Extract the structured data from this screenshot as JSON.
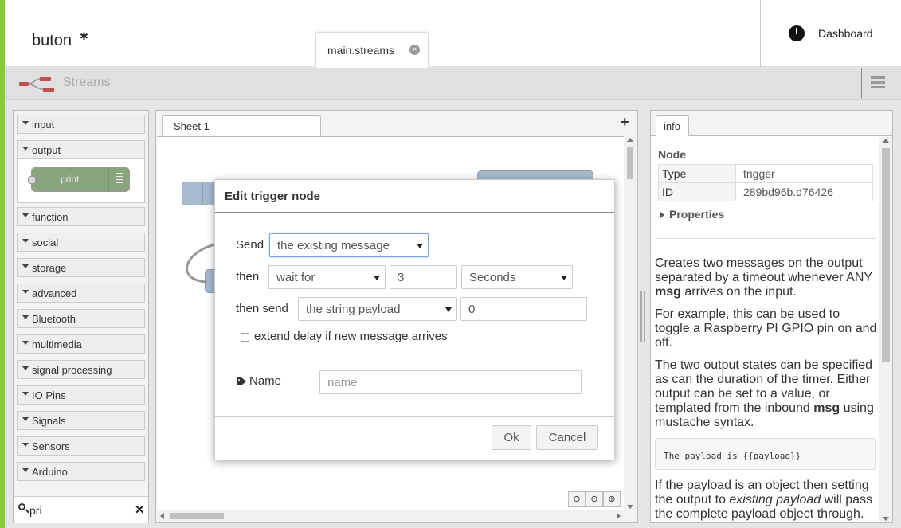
{
  "header": {
    "app_title": "buton",
    "file_tab": "main.streams",
    "dashboard_label": "Dashboard"
  },
  "streams_bar": {
    "title": "Streams"
  },
  "palette": {
    "categories": [
      {
        "label": "input"
      },
      {
        "label": "output"
      },
      {
        "label": "function"
      },
      {
        "label": "social"
      },
      {
        "label": "storage"
      },
      {
        "label": "advanced"
      },
      {
        "label": "Bluetooth"
      },
      {
        "label": "multimedia"
      },
      {
        "label": "signal processing"
      },
      {
        "label": "IO Pins"
      },
      {
        "label": "Signals"
      },
      {
        "label": "Sensors"
      },
      {
        "label": "Arduino"
      }
    ],
    "output_node": "print",
    "search_value": "pri"
  },
  "workspace": {
    "sheet_tab": "Sheet 1"
  },
  "sidebar": {
    "tab": "info",
    "node_header": "Node",
    "rows": [
      {
        "key": "Type",
        "value": "trigger"
      },
      {
        "key": "ID",
        "value": "289bd96b.d76426"
      }
    ],
    "properties_label": "Properties",
    "code_sample": "The payload is {{payload}}"
  },
  "dialog": {
    "title": "Edit trigger node",
    "send_label": "Send",
    "send_value": "the existing message",
    "then_label": "then",
    "then_value": "wait for",
    "delay_value": "3",
    "units_value": "Seconds",
    "then_send_label": "then send",
    "then_send_value": "the string payload",
    "payload_value": "0",
    "extend_label": "extend delay if new message arrives",
    "name_label": "Name",
    "name_placeholder": "name",
    "ok_label": "Ok",
    "cancel_label": "Cancel"
  }
}
